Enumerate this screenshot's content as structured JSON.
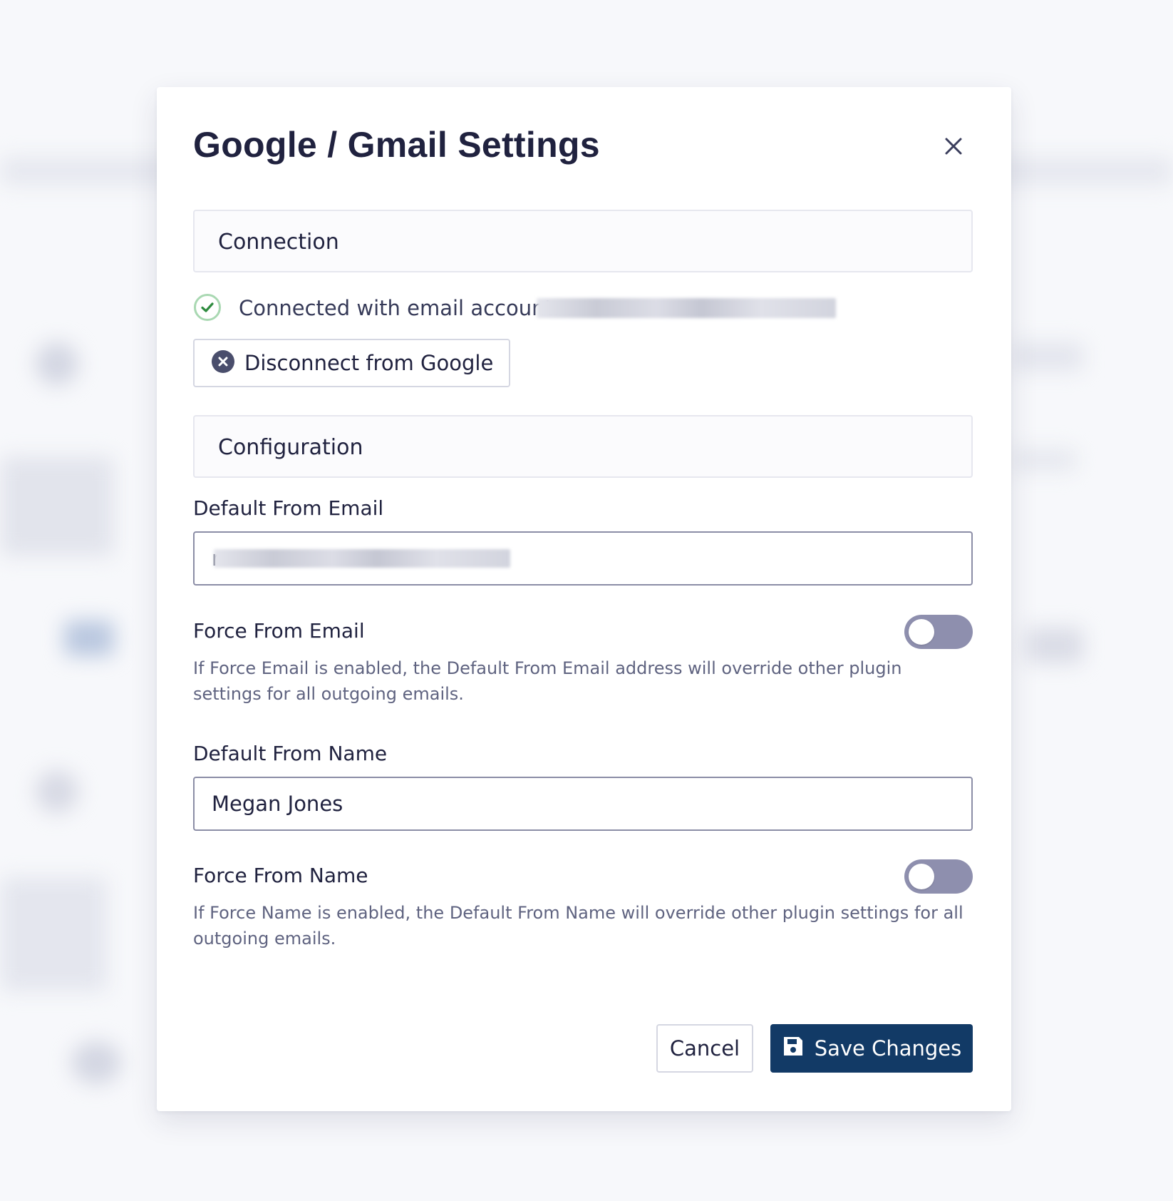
{
  "modal": {
    "title": "Google / Gmail Settings"
  },
  "connection": {
    "section_title": "Connection",
    "status_text": "Connected with email account: r",
    "status_color": "#2e8b3e",
    "disconnect_label": "Disconnect from Google"
  },
  "configuration": {
    "section_title": "Configuration",
    "default_from_email": {
      "label": "Default From Email",
      "value": "r"
    },
    "force_from_email": {
      "label": "Force From Email",
      "enabled": false,
      "help": "If Force Email is enabled, the Default From Email address will override other plugin settings for all outgoing emails."
    },
    "default_from_name": {
      "label": "Default From Name",
      "value": "Megan Jones"
    },
    "force_from_name": {
      "label": "Force From Name",
      "enabled": false,
      "help": "If Force Name is enabled, the Default From Name will override other plugin settings for all outgoing emails."
    }
  },
  "footer": {
    "cancel_label": "Cancel",
    "save_label": "Save Changes"
  },
  "colors": {
    "primary": "#123a66",
    "text": "#20223f",
    "toggle_off": "#8e8fae"
  },
  "icons": {
    "close": "close-icon",
    "status": "check-circle-icon",
    "disconnect": "x-circle-icon",
    "save": "floppy-disk-icon"
  }
}
